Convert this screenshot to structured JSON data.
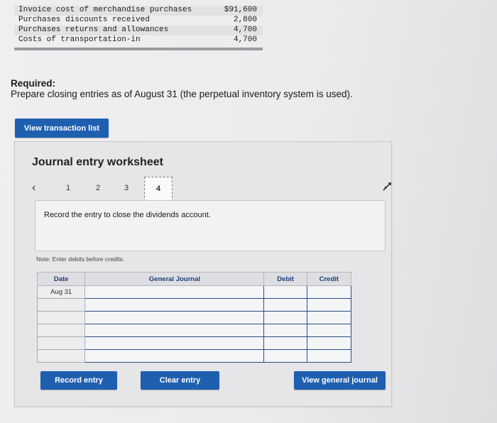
{
  "data_rows": [
    {
      "label": "Invoice cost of merchandise purchases",
      "amount": "$91,600"
    },
    {
      "label": "Purchases discounts received",
      "amount": "2,800"
    },
    {
      "label": "Purchases returns and allowances",
      "amount": "4,700"
    },
    {
      "label": "Costs of transportation-in",
      "amount": "4,700"
    }
  ],
  "required": {
    "heading": "Required:",
    "text": "Prepare closing entries as of August 31 (the perpetual inventory system is used)."
  },
  "buttons": {
    "view_transactions": "View transaction list",
    "record": "Record entry",
    "clear": "Clear entry",
    "view_journal": "View general journal"
  },
  "worksheet": {
    "title": "Journal entry worksheet",
    "pages": [
      "1",
      "2",
      "3",
      "4"
    ],
    "active_page": "4",
    "prompt": "Record the entry to close the dividends account.",
    "note": "Note: Enter debits before credits.",
    "columns": {
      "date": "Date",
      "general_journal": "General Journal",
      "debit": "Debit",
      "credit": "Credit"
    },
    "first_date": "Aug 31"
  },
  "icons": {
    "prev": "chevron-left-icon",
    "cursor": "mouse-pointer-icon"
  },
  "colors": {
    "button": "#1f5fb0",
    "header_text": "#1d3f78"
  }
}
